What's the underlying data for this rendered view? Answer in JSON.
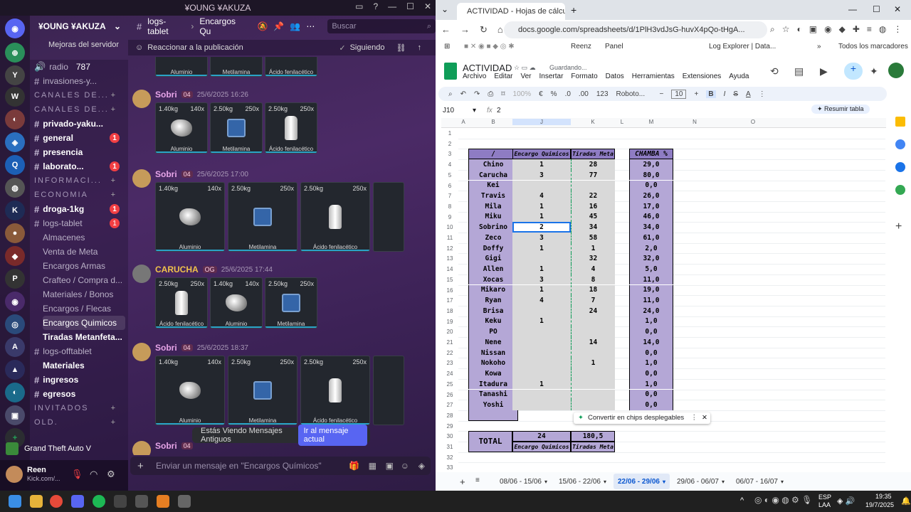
{
  "discord": {
    "window_title": "¥OUNG ¥AKUZA",
    "server_name": "¥OUNG ¥AKUZA",
    "channel_name": "logs-tablet",
    "thread_name": "Encargos Qu",
    "search_placeholder": "Buscar",
    "boost_label": "Mejoras del servidor",
    "react_label": "Reaccionar a la publicación",
    "following_label": "Siguiendo",
    "channels": [
      {
        "label": "radio",
        "count": "787",
        "type": "voice"
      },
      {
        "label": "invasiones-y...",
        "type": "text"
      },
      {
        "label": "CANALES DE...",
        "type": "category"
      },
      {
        "label": "CANALES DE...",
        "type": "category"
      },
      {
        "label": "privado-yaku...",
        "type": "text",
        "bold": true
      },
      {
        "label": "general",
        "badge": "1",
        "type": "text",
        "bold": true
      },
      {
        "label": "presencia",
        "type": "text",
        "bold": true
      },
      {
        "label": "laborato...",
        "badge": "1",
        "type": "text",
        "bold": true
      },
      {
        "label": "INFORMACI...",
        "type": "category"
      },
      {
        "label": "ECONOMIA",
        "type": "category"
      },
      {
        "label": "droga-1kg",
        "badge": "1",
        "type": "text",
        "bold": true
      },
      {
        "label": "logs-tablet",
        "badge": "1",
        "type": "forum"
      },
      {
        "label": "Almacenes",
        "type": "thread"
      },
      {
        "label": "Venta de Meta",
        "type": "thread"
      },
      {
        "label": "Encargos Armas",
        "type": "thread"
      },
      {
        "label": "Crafteo / Compra d...",
        "type": "thread"
      },
      {
        "label": "Materiales / Bonos",
        "type": "thread"
      },
      {
        "label": "Encargos / Flecas",
        "type": "thread"
      },
      {
        "label": "Encargos Quimicos",
        "type": "thread",
        "selected": true
      },
      {
        "label": "Tiradas Metanfeta...",
        "type": "thread",
        "bold": true
      },
      {
        "label": "logs-offtablet",
        "type": "forum"
      },
      {
        "label": "Materiales",
        "type": "thread",
        "bold": true
      },
      {
        "label": "ingresos",
        "type": "text",
        "bold": true
      },
      {
        "label": "egresos",
        "type": "text",
        "bold": true
      },
      {
        "label": "INVITADOS",
        "type": "category"
      },
      {
        "label": "old.",
        "type": "category"
      }
    ],
    "activity": "Grand Theft Auto V",
    "user": {
      "name": "Reen",
      "status": "Kick.com/..."
    },
    "messages": [
      {
        "author": "Sobri",
        "tag": "04",
        "time": "25/6/2025 16:26",
        "cards": [
          {
            "w": "1.40kg",
            "q": "140x",
            "label": "Aluminio"
          },
          {
            "w": "2.50kg",
            "q": "250x",
            "label": "Metilamina"
          },
          {
            "w": "2.50kg",
            "q": "250x",
            "label": "Ácido fenilacético"
          }
        ]
      },
      {
        "author": "Sobri",
        "tag": "04",
        "time": "25/6/2025 17:00",
        "cards": [
          {
            "w": "1.40kg",
            "q": "140x",
            "label": "Aluminio"
          },
          {
            "w": "2.50kg",
            "q": "250x",
            "label": "Metilamina"
          },
          {
            "w": "2.50kg",
            "q": "250x",
            "label": "Ácido fenilacético"
          }
        ]
      },
      {
        "author": "CARUCHA",
        "tag": "OG",
        "time": "25/6/2025 17:44",
        "cards": [
          {
            "w": "2.50kg",
            "q": "250x",
            "label": "Ácido fenilacético"
          },
          {
            "w": "1.40kg",
            "q": "140x",
            "label": "Aluminio"
          },
          {
            "w": "2.50kg",
            "q": "250x",
            "label": "Metilamina"
          }
        ]
      },
      {
        "author": "Sobri",
        "tag": "04",
        "time": "25/6/2025 18:37",
        "cards": [
          {
            "w": "1.40kg",
            "q": "140x",
            "label": "Aluminio"
          },
          {
            "w": "2.50kg",
            "q": "250x",
            "label": "Metilamina"
          },
          {
            "w": "2.50kg",
            "q": "250x",
            "label": "Ácido fenilacético"
          }
        ]
      }
    ],
    "top_cards": [
      {
        "label": "Aluminio"
      },
      {
        "label": "Metilamina"
      },
      {
        "label": "Ácido fenilacético"
      }
    ],
    "last_author": "Sobri",
    "last_tag": "04",
    "old_messages_label": "Estás Viendo Mensajes Antiguos",
    "jump_label": "Ir al mensaje actual",
    "composer_placeholder": "Enviar un mensaje en \"Encargos Químicos\""
  },
  "chrome": {
    "tab_title": "ACTIVIDAD - Hojas de cálculo",
    "url": "docs.google.com/spreadsheets/d/1PlH3vdJsG-huvX4pQo-tHgA...",
    "bookmarks": [
      "Reenz",
      "Panel",
      "Log Explorer | Data...",
      "Todos los marcadores"
    ],
    "doc_title": "ACTIVIDAD",
    "saving": "Guardando...",
    "menu": [
      "Archivo",
      "Editar",
      "Ver",
      "Insertar",
      "Formato",
      "Datos",
      "Herramientas",
      "Extensiones",
      "Ayuda"
    ],
    "zoom": "100%",
    "currency": "€",
    "percent": "%",
    "dec_less": ".0",
    "dec_more": ".00",
    "num_fmt": "123",
    "font": "Roboto...",
    "font_size": "10",
    "cell_ref": "J10",
    "formula_value": "2",
    "summary_btn": "Resumir tabla",
    "chips_suggestion": "Convertir en chips desplegables",
    "columns": [
      "A",
      "B",
      "J",
      "K",
      "L",
      "M",
      "N",
      "O"
    ],
    "headers": {
      "b": "/",
      "j": "Encargo Quimicos",
      "k": "Tiradas Meta",
      "m": "CHAMBA %"
    },
    "rows": [
      {
        "r": "4",
        "name": "Chino",
        "j": "1",
        "k": "28",
        "m": "29,0"
      },
      {
        "r": "5",
        "name": "Carucha",
        "j": "3",
        "k": "77",
        "m": "80,0"
      },
      {
        "r": "6",
        "name": "Kei",
        "j": "",
        "k": "",
        "m": "0,0"
      },
      {
        "r": "7",
        "name": "Travis",
        "j": "4",
        "k": "22",
        "m": "26,0"
      },
      {
        "r": "8",
        "name": "Mila",
        "j": "1",
        "k": "16",
        "m": "17,0"
      },
      {
        "r": "9",
        "name": "Miku",
        "j": "1",
        "k": "45",
        "m": "46,0"
      },
      {
        "r": "10",
        "name": "Sobrino",
        "j": "2",
        "k": "34",
        "m": "34,0"
      },
      {
        "r": "11",
        "name": "Zeco",
        "j": "3",
        "k": "58",
        "m": "61,0"
      },
      {
        "r": "12",
        "name": "Doffy",
        "j": "1",
        "k": "1",
        "m": "2,0"
      },
      {
        "r": "13",
        "name": "Gigi",
        "j": "",
        "k": "32",
        "m": "32,0"
      },
      {
        "r": "14",
        "name": "Allen",
        "j": "1",
        "k": "4",
        "m": "5,0"
      },
      {
        "r": "15",
        "name": "Xocas",
        "j": "3",
        "k": "8",
        "m": "11,0"
      },
      {
        "r": "16",
        "name": "Mikaro",
        "j": "1",
        "k": "18",
        "m": "19,0"
      },
      {
        "r": "17",
        "name": "Ryan",
        "j": "4",
        "k": "7",
        "m": "11,0"
      },
      {
        "r": "18",
        "name": "Brisa",
        "j": "",
        "k": "24",
        "m": "24,0"
      },
      {
        "r": "19",
        "name": "Keku",
        "j": "1",
        "k": "",
        "m": "1,0"
      },
      {
        "r": "20",
        "name": "PO",
        "j": "",
        "k": "",
        "m": "0,0"
      },
      {
        "r": "21",
        "name": "Nene",
        "j": "",
        "k": "14",
        "m": "14,0"
      },
      {
        "r": "22",
        "name": "Nissan",
        "j": "",
        "k": "",
        "m": "0,0"
      },
      {
        "r": "23",
        "name": "Nokoho",
        "j": "",
        "k": "1",
        "m": "1,0"
      },
      {
        "r": "24",
        "name": "Kowa",
        "j": "",
        "k": "",
        "m": "0,0"
      },
      {
        "r": "25",
        "name": "Itadura",
        "j": "1",
        "k": "",
        "m": "1,0"
      },
      {
        "r": "26",
        "name": "Tanashi",
        "j": "",
        "k": "",
        "m": "0,0"
      },
      {
        "r": "27",
        "name": "Yoshi",
        "j": "",
        "k": "",
        "m": "0,0"
      }
    ],
    "total_label": "TOTAL",
    "total_j": "24",
    "total_k": "180,5",
    "sheet_tabs": [
      "08/06 - 15/06",
      "15/06 - 22/06",
      "22/06 - 29/06",
      "29/06 - 06/07",
      "06/07 - 16/07"
    ],
    "active_sheet": "22/06 - 29/06"
  },
  "taskbar": {
    "lang": "ESP",
    "layout": "LAA",
    "time": "19:35",
    "date": "19/7/2025",
    "search": "Búsqueda"
  }
}
